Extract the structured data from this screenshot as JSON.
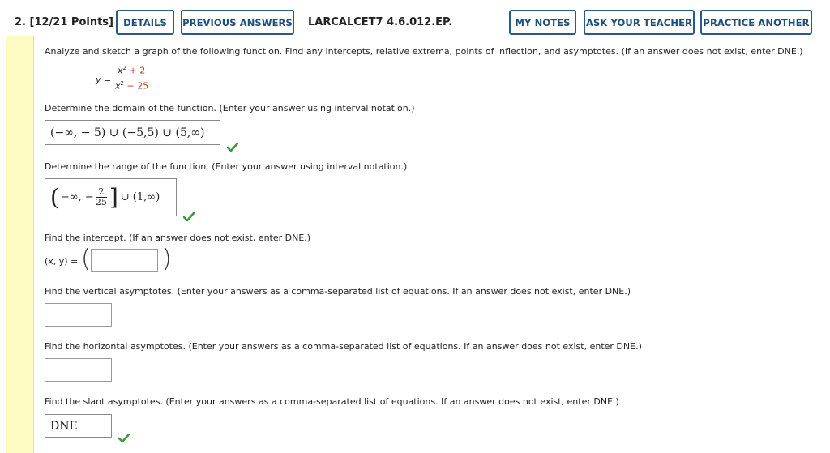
{
  "header": {
    "question_number": "2.",
    "points": "[12/21 Points]",
    "details_label": "DETAILS",
    "previous_answers_label": "PREVIOUS ANSWERS",
    "question_id": "LARCALCET7 4.6.012.EP.",
    "my_notes_label": "MY NOTES",
    "ask_teacher_label": "ASK YOUR TEACHER",
    "practice_another_label": "PRACTICE ANOTHER",
    "button_color": "#2a5a8a"
  },
  "problem": {
    "instructions": "Analyze and sketch a graph of the following function. Find any intercepts, relative extrema, points of inflection, and asymptotes. (If an answer does not exist, enter DNE.)",
    "function_lhs": "y =",
    "numerator": "x",
    "numerator_const": "+ 2",
    "denominator": "x",
    "denominator_const": "− 25",
    "exponent": "2",
    "const_color": "#c0392b"
  },
  "domain": {
    "prompt": "Determine the domain of the function. (Enter your answer using interval notation.)",
    "answer": "(−∞, − 5) ∪ (−5,5) ∪ (5,∞)",
    "status": "correct"
  },
  "range": {
    "prompt": "Determine the range of the function. (Enter your answer using interval notation.)",
    "answer_left": "−∞, −",
    "fraction_num": "2",
    "fraction_den": "25",
    "answer_right": "∪ (1,∞)",
    "status": "correct"
  },
  "intercept": {
    "prompt": "Find the intercept. (If an answer does not exist, enter DNE.)",
    "label": "(x, y) =",
    "value": ""
  },
  "vertical_asymptotes": {
    "prompt": "Find the vertical asymptotes. (Enter your answers as a comma-separated list of equations. If an answer does not exist, enter DNE.)",
    "value": ""
  },
  "horizontal_asymptotes": {
    "prompt": "Find the horizontal asymptotes. (Enter your answers as a comma-separated list of equations. If an answer does not exist, enter DNE.)",
    "value": ""
  },
  "slant_asymptotes": {
    "prompt": "Find the slant asymptotes. (Enter your answers as a comma-separated list of equations. If an answer does not exist, enter DNE.)",
    "value": "DNE",
    "status": "correct"
  },
  "icons": {
    "correct": "check-icon"
  },
  "colors": {
    "check": "#3d9a3d",
    "left_bar": "#fdfbc2"
  }
}
